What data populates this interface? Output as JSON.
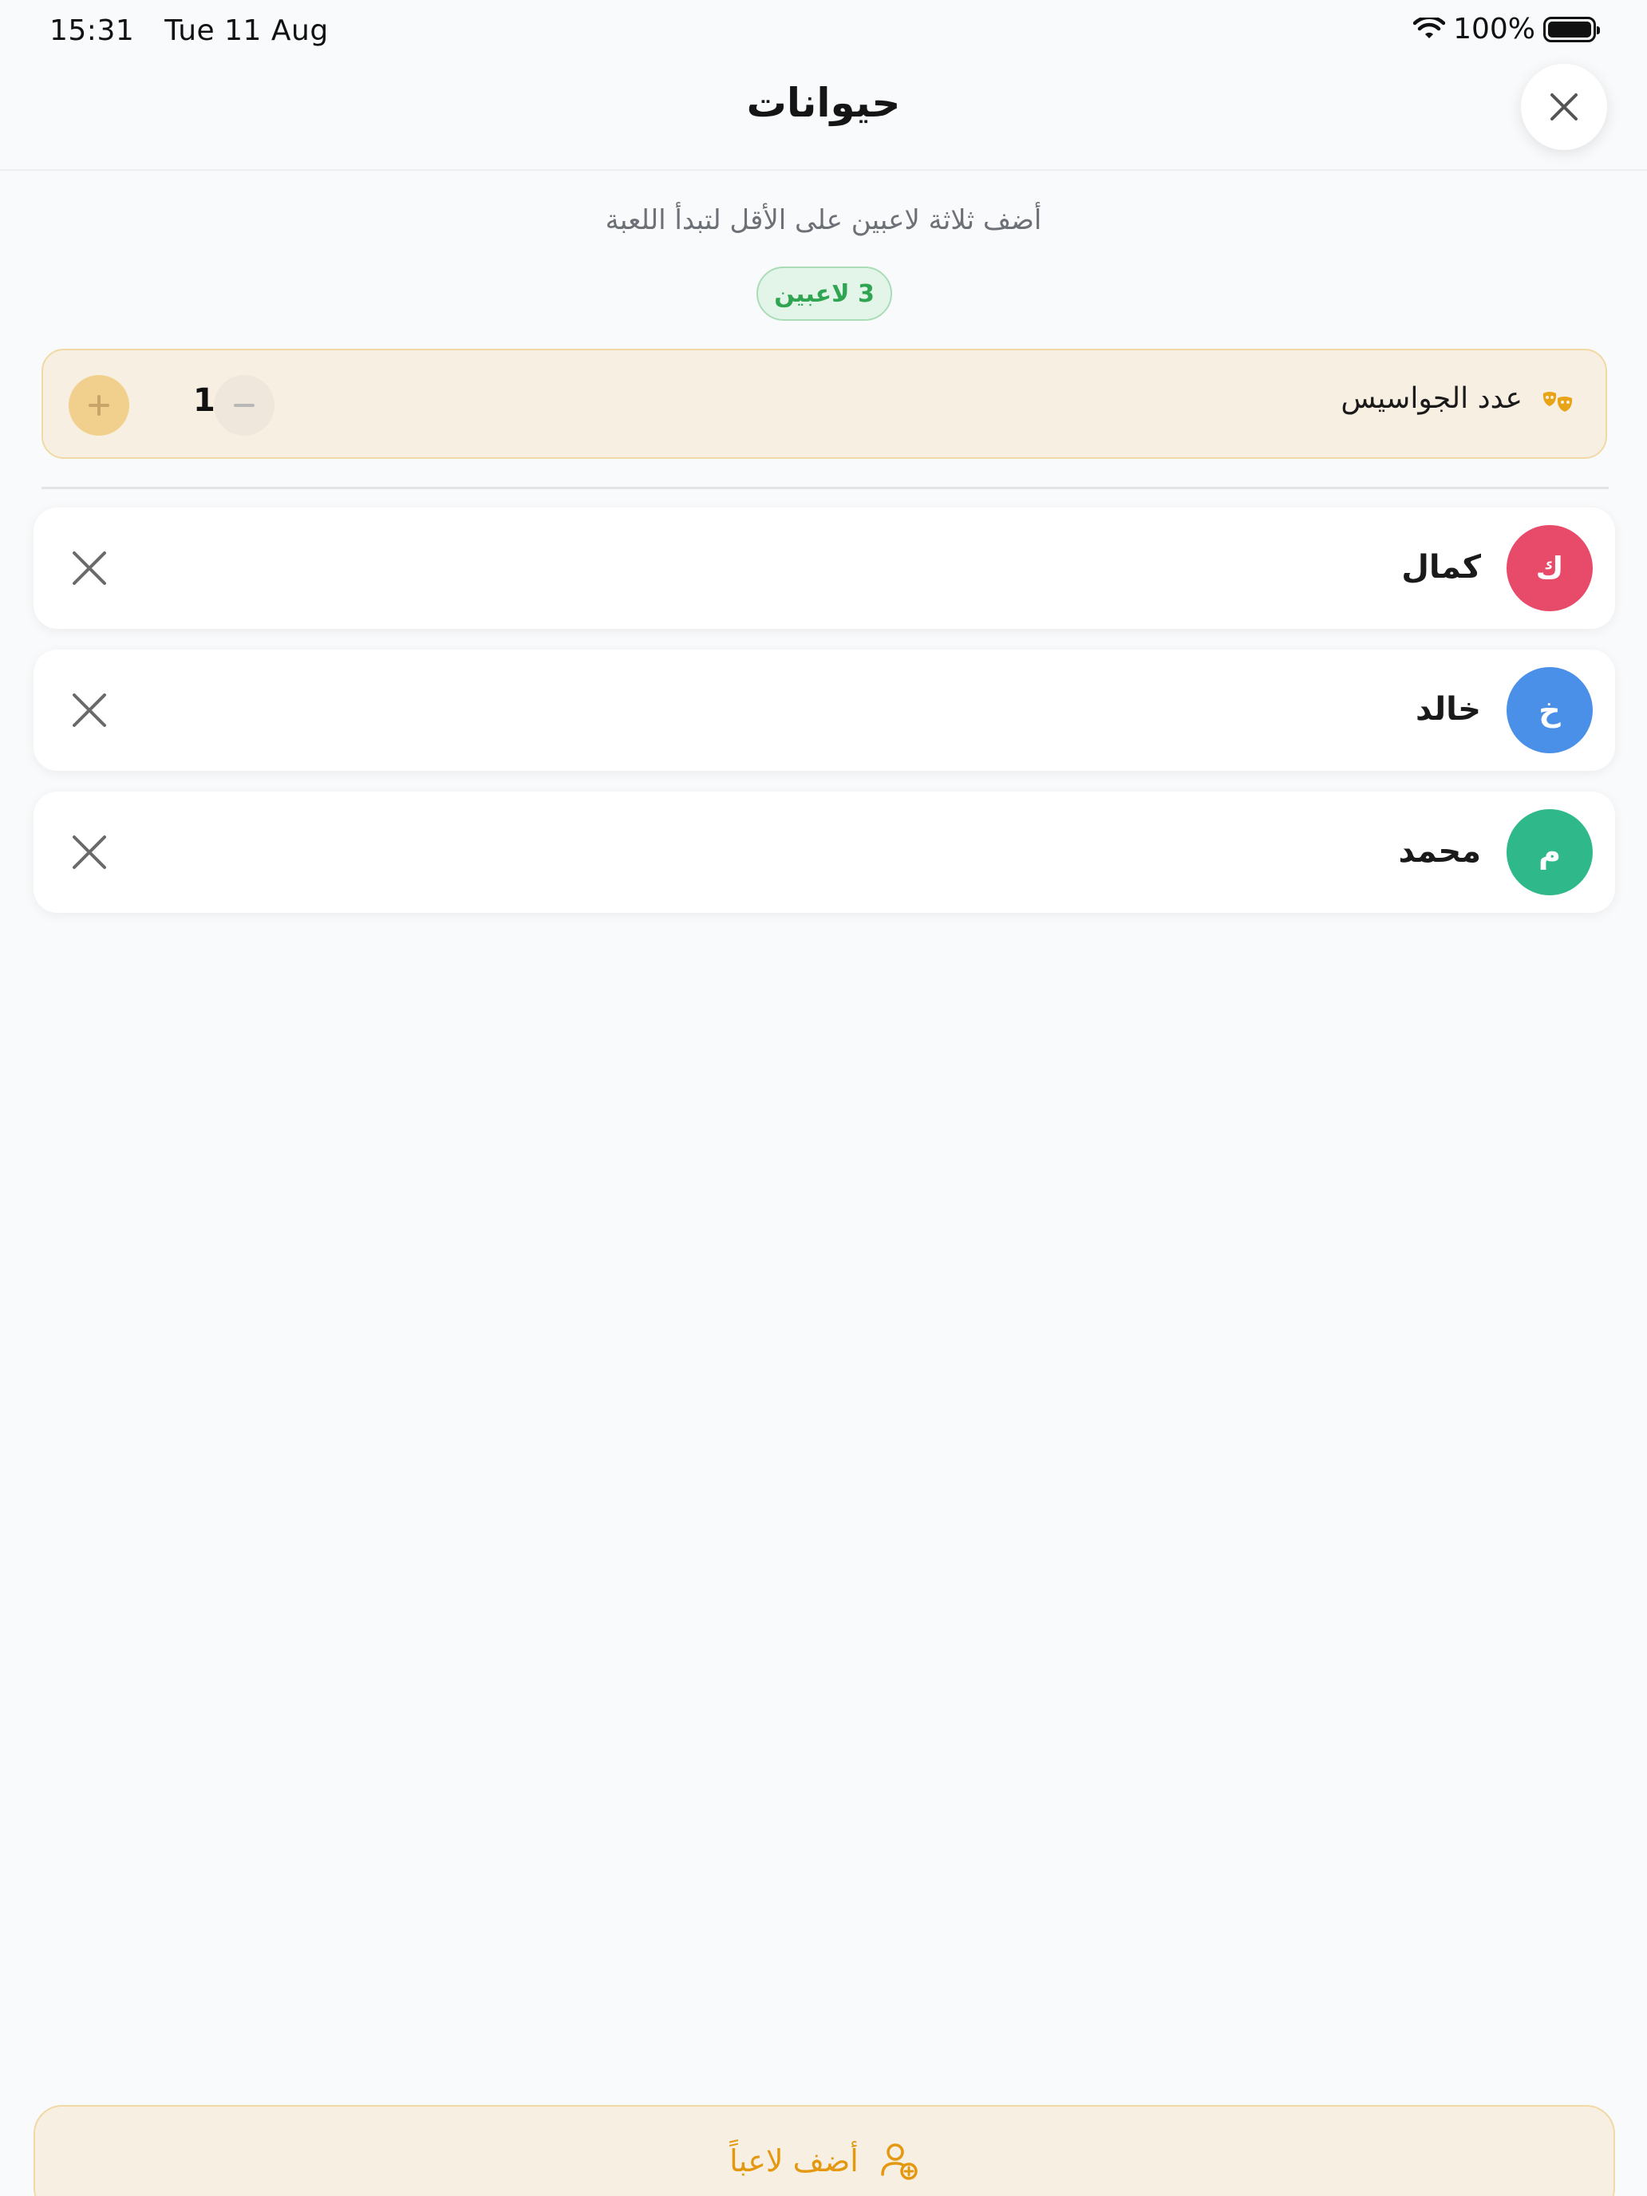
{
  "status_bar": {
    "time": "15:31",
    "date": "Tue 11 Aug",
    "battery_percent": "100%",
    "icons": [
      "wifi-icon",
      "battery-icon"
    ]
  },
  "header": {
    "title": "حيوانات",
    "close_icon": "close-icon"
  },
  "info": {
    "subtitle": "أضف ثلاثة لاعبين على الأقل لتبدأ اللعبة",
    "player_count": "3 لاعبين"
  },
  "spy_setting": {
    "label": "عدد الجواسيس",
    "icon": "masks-icon",
    "value": "1",
    "plus_icon": "plus-icon",
    "minus_icon": "minus-icon"
  },
  "players": [
    {
      "name": "كمال",
      "initial": "ك",
      "color": "#e84a6a"
    },
    {
      "name": "خالد",
      "initial": "خ",
      "color": "#4a8fe8"
    },
    {
      "name": "محمد",
      "initial": "م",
      "color": "#2fb98a"
    }
  ],
  "add_button": {
    "label": "أضف لاعباً",
    "icon": "add-user-icon"
  },
  "colors": {
    "accent": "#e3980f",
    "accent_bg": "#f8efe3",
    "success": "#2fa451"
  }
}
